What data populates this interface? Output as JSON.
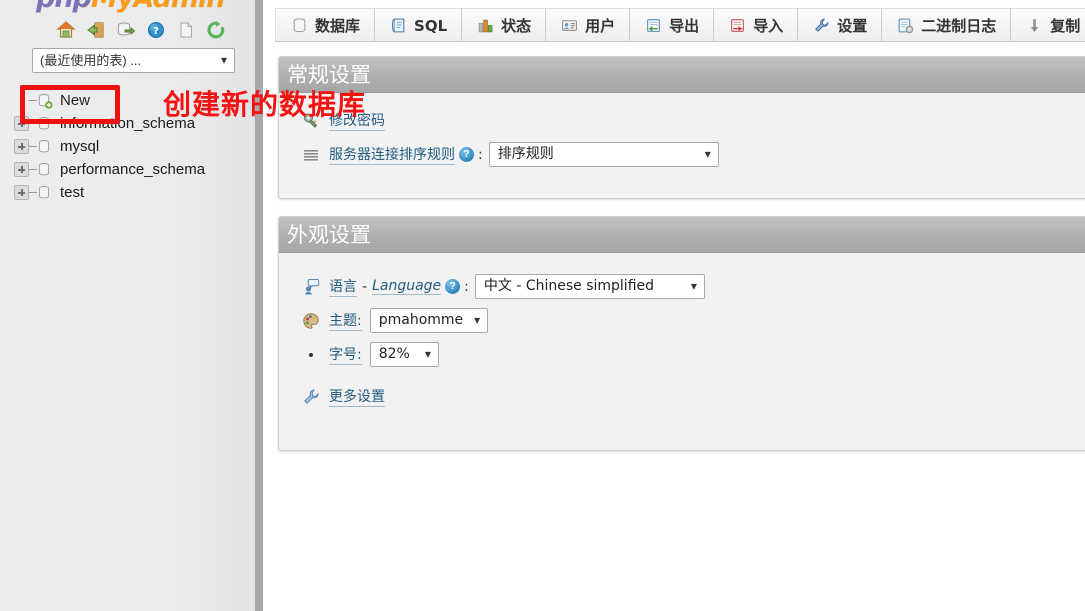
{
  "app": {
    "logo_php": "php",
    "logo_myadmin": "MyAdmin"
  },
  "sidebar": {
    "nav_icons": [
      {
        "name": "home-icon",
        "title": "主页"
      },
      {
        "name": "logout-icon",
        "title": "退出"
      },
      {
        "name": "sql-export-icon",
        "title": "查询"
      },
      {
        "name": "help-icon",
        "title": "帮助"
      },
      {
        "name": "docs-icon",
        "title": "文档"
      },
      {
        "name": "reload-icon",
        "title": "重新加载"
      }
    ],
    "recent_tables_label": "(最近使用的表) ...",
    "tree": [
      {
        "label": "New",
        "expandable": false,
        "is_new": true
      },
      {
        "label": "information_schema",
        "expandable": true,
        "is_new": false
      },
      {
        "label": "mysql",
        "expandable": true,
        "is_new": false
      },
      {
        "label": "performance_schema",
        "expandable": true,
        "is_new": false
      },
      {
        "label": "test",
        "expandable": true,
        "is_new": false
      }
    ]
  },
  "annotation": {
    "text": "创建新的数据库",
    "color": "#f51212",
    "highlight_color": "#ee1111"
  },
  "topnav": {
    "tabs": [
      {
        "label": "数据库",
        "icon": "database-icon"
      },
      {
        "label": "SQL",
        "icon": "sql-scroll-icon"
      },
      {
        "label": "状态",
        "icon": "status-chart-icon"
      },
      {
        "label": "用户",
        "icon": "users-card-icon"
      },
      {
        "label": "导出",
        "icon": "export-icon"
      },
      {
        "label": "导入",
        "icon": "import-icon"
      },
      {
        "label": "设置",
        "icon": "wrench-icon"
      },
      {
        "label": "二进制日志",
        "icon": "binlog-icon"
      },
      {
        "label": "复制",
        "icon": "replication-icon"
      }
    ]
  },
  "general_settings": {
    "title": "常规设置",
    "change_password_label": "修改密码",
    "collation_label": "服务器连接排序规则",
    "collation_help": "?",
    "collation_separator": ":",
    "collation_value": "排序规则"
  },
  "appearance_settings": {
    "title": "外观设置",
    "language_label_cn": "语言",
    "language_dash": "-",
    "language_label_en": "Language",
    "language_help": "?",
    "language_separator": ":",
    "language_value": "中文 - Chinese simplified",
    "theme_label": "主题:",
    "theme_value": "pmahomme",
    "fontsize_label": "字号:",
    "fontsize_value": "82%",
    "more_settings_label": "更多设置"
  },
  "colors": {
    "panel_header_start": "#c2c2c2",
    "panel_header_end": "#a6a6a6",
    "panel_body": "#f2f2f2",
    "link": "#235a81",
    "sidebar_bg": "#eceded",
    "logo_php": "#7c73b5",
    "logo_myadmin": "#f79c1c"
  }
}
